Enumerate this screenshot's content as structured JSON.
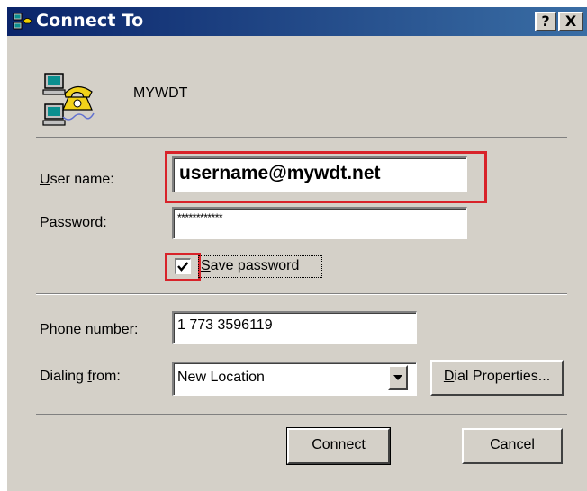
{
  "window": {
    "title": "Connect To",
    "help_label": "?",
    "close_label": "X"
  },
  "connection": {
    "name": "MYWDT"
  },
  "credentials": {
    "username_label_key": "U",
    "username_label_rest": "ser name:",
    "username_value": "username@mywdt.net",
    "password_label_key": "P",
    "password_label_rest": "assword:",
    "password_value": "************",
    "save_password_key": "S",
    "save_password_rest": "ave password",
    "save_password_checked": true
  },
  "dialing": {
    "phone_label_before": "Phone ",
    "phone_label_key": "n",
    "phone_label_after": "umber:",
    "phone_value": "1 773 3596119",
    "dialing_from_label_before": "Dialing ",
    "dialing_from_label_key": "f",
    "dialing_from_label_after": "rom:",
    "dialing_from_value": "New Location",
    "dial_properties_key": "D",
    "dial_properties_rest": "ial Properties..."
  },
  "buttons": {
    "connect_label": "Connect",
    "cancel_label": "Cancel"
  },
  "icons": [
    "connection-computers-phone-icon",
    "checkmark-icon",
    "dropdown-arrow-icon"
  ],
  "colors": {
    "titlebar_start": "#0a246a",
    "titlebar_end": "#3a6ea5",
    "dialog_face": "#d4d0c8",
    "highlight_box": "#d8232a"
  }
}
